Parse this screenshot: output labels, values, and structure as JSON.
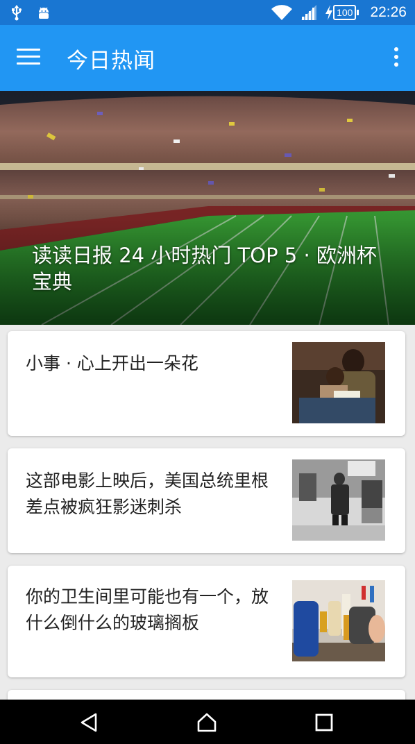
{
  "status_bar": {
    "time": "22:26",
    "battery_level": "100",
    "icons": [
      "usb-icon",
      "android-icon",
      "wifi-icon",
      "signal-icon",
      "charging-icon"
    ]
  },
  "app_bar": {
    "title": "今日热闻",
    "menu_icon": "hamburger-menu-icon",
    "overflow_icon": "overflow-menu-icon"
  },
  "hero": {
    "title": "读读日报 24 小时热门 TOP 5 · 欧洲杯宝典"
  },
  "stories": [
    {
      "title": "小事 · 心上开出一朵花"
    },
    {
      "title": "这部电影上映后，美国总统里根差点被疯狂影迷刺杀"
    },
    {
      "title": "你的卫生间里可能也有一个，放什么倒什么的玻璃搁板"
    }
  ],
  "nav_bar": {
    "icons": [
      "back-icon",
      "home-icon",
      "recents-icon"
    ]
  }
}
